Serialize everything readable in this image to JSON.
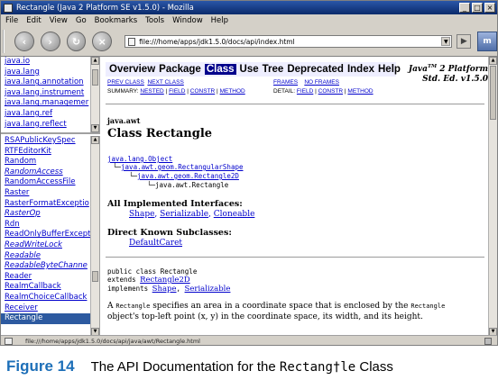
{
  "window": {
    "title": "Rectangle (Java 2 Platform SE v1.5.0) - Mozilla",
    "controls": [
      "_",
      "□",
      "×"
    ]
  },
  "menu": [
    "File",
    "Edit",
    "View",
    "Go",
    "Bookmarks",
    "Tools",
    "Window",
    "Help"
  ],
  "url": "file:///home/apps/jdk1.5.0/docs/api/index.html",
  "packages": [
    "java.io",
    "java.lang",
    "java.lang.annotation",
    "java.lang.instrument",
    "java.lang.managemer",
    "java.lang.ref",
    "java.lang.reflect"
  ],
  "classes": [
    {
      "name": "RSAPublicKeySpec",
      "italic": false
    },
    {
      "name": "RTFEditorKit",
      "italic": false
    },
    {
      "name": "Random",
      "italic": false
    },
    {
      "name": "RandomAccess",
      "italic": true
    },
    {
      "name": "RandomAccessFile",
      "italic": false
    },
    {
      "name": "Raster",
      "italic": false
    },
    {
      "name": "RasterFormatExceptio",
      "italic": false
    },
    {
      "name": "RasterOp",
      "italic": true
    },
    {
      "name": "Rdn",
      "italic": false
    },
    {
      "name": "ReadOnlyBufferExcept",
      "italic": false
    },
    {
      "name": "ReadWriteLock",
      "italic": true
    },
    {
      "name": "Readable",
      "italic": true
    },
    {
      "name": "ReadableByteChanne",
      "italic": true
    },
    {
      "name": "Reader",
      "italic": false
    },
    {
      "name": "RealmCallback",
      "italic": false
    },
    {
      "name": "RealmChoiceCallback",
      "italic": false
    },
    {
      "name": "Receiver",
      "italic": false
    },
    {
      "name": "Rectangle",
      "italic": false,
      "selected": true
    }
  ],
  "doc": {
    "nav": {
      "overview": "Overview",
      "package": "Package",
      "class": "Class",
      "use": "Use",
      "tree": "Tree",
      "deprecated": "Deprecated",
      "index": "Index",
      "help": "Help"
    },
    "brand_line1": "Java",
    "brand_tm": "TM",
    "brand_line1_rest": " 2 Platform",
    "brand_line2": "Std. Ed. v1.5.0",
    "prev_class": "PREV CLASS",
    "next_class": "NEXT CLASS",
    "frames": "FRAMES",
    "no_frames": "NO FRAMES",
    "summary_label": "SUMMARY:",
    "summary_nested": "NESTED",
    "summary_field": "FIELD",
    "summary_constr": "CONSTR",
    "summary_method": "METHOD",
    "detail_label": "DETAIL:",
    "detail_field": "FIELD",
    "detail_constr": "CONSTR",
    "detail_method": "METHOD",
    "package_name": "java.awt",
    "class_title": "Class Rectangle",
    "hierarchy": [
      "java.lang.Object",
      "java.awt.geom.RectangularShape",
      "java.awt.geom.Rectangle2D",
      "java.awt.Rectangle"
    ],
    "interfaces_heading": "All Implemented Interfaces:",
    "interfaces": [
      "Shape",
      "Serializable",
      "Cloneable"
    ],
    "subclasses_heading": "Direct Known Subclasses:",
    "subclasses": [
      "DefaultCaret"
    ],
    "decl_line1": "public class Rectangle",
    "decl_extends_kw": "extends",
    "decl_extends": "Rectangle2D",
    "decl_implements_kw": "implements",
    "decl_impl1": "Shape",
    "decl_impl2": "Serializable",
    "desc_a": "A",
    "desc_code1": "Rectangle",
    "desc_mid": "specifies an area in a coordinate space that is enclosed by the",
    "desc_code2": "Rectangle",
    "desc_line2": "object's top-left point (x, y) in the coordinate space, its width, and its height."
  },
  "status": "file:///home/apps/jdk1.5.0/docs/api/java/awt/Rectangle.html",
  "caption": {
    "label": "Figure 14",
    "text": "The API Documentation for the",
    "mono": "Rectang†le",
    "end": "Class"
  },
  "accent_color": "#1d6fb8",
  "link_color": "#0000cc"
}
